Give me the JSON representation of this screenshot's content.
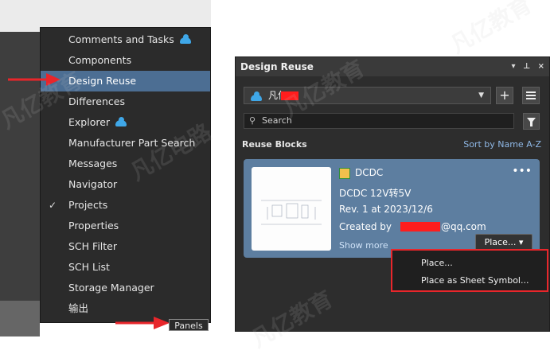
{
  "panels_menu": {
    "items": [
      {
        "label": "Comments and Tasks",
        "cloud": true,
        "checked": false,
        "selected": false
      },
      {
        "label": "Components",
        "cloud": false,
        "checked": false,
        "selected": false
      },
      {
        "label": "Design Reuse",
        "cloud": false,
        "checked": false,
        "selected": true
      },
      {
        "label": "Differences",
        "cloud": false,
        "checked": false,
        "selected": false
      },
      {
        "label": "Explorer",
        "cloud": true,
        "checked": false,
        "selected": false
      },
      {
        "label": "Manufacturer Part Search",
        "cloud": false,
        "checked": false,
        "selected": false
      },
      {
        "label": "Messages",
        "cloud": false,
        "checked": false,
        "selected": false
      },
      {
        "label": "Navigator",
        "cloud": false,
        "checked": false,
        "selected": false
      },
      {
        "label": "Projects",
        "cloud": false,
        "checked": true,
        "selected": false
      },
      {
        "label": "Properties",
        "cloud": false,
        "checked": false,
        "selected": false
      },
      {
        "label": "SCH Filter",
        "cloud": false,
        "checked": false,
        "selected": false
      },
      {
        "label": "SCH List",
        "cloud": false,
        "checked": false,
        "selected": false
      },
      {
        "label": "Storage Manager",
        "cloud": false,
        "checked": false,
        "selected": false
      },
      {
        "label": "输出",
        "cloud": false,
        "checked": false,
        "selected": false
      }
    ],
    "panels_button_label": "Panels"
  },
  "design_reuse": {
    "title": "Design Reuse",
    "header_controls": {
      "menu": "▾",
      "pin": "⊥",
      "close": "×"
    },
    "library_name": "凡亿",
    "search_placeholder": "Search",
    "section_label": "Reuse Blocks",
    "sort_label": "Sort by Name A-Z",
    "block": {
      "name": "DCDC",
      "description": "DCDC 12V转5V",
      "revision": "Rev. 1 at 2023/12/6",
      "created_by_prefix": "Created by",
      "created_by_suffix": "@qq.com",
      "show_more": "Show more",
      "place_button": "Place... ▾"
    },
    "place_menu": [
      "Place...",
      "Place as Sheet Symbol..."
    ]
  },
  "watermarks": [
    "凡亿教育",
    "凡亿电路",
    "凡亿教育",
    "凡亿教育",
    "凡亿教育"
  ],
  "colors": {
    "selected_row": "#4c6e93",
    "card": "#5d7ea0",
    "annotation_red": "#e8262b",
    "cloud": "#3fa7e8"
  }
}
